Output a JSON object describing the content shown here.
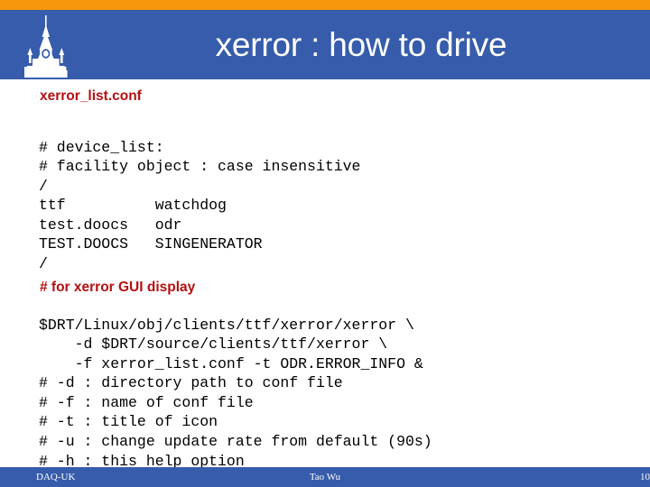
{
  "theme": {
    "accent_orange": "#F7970B",
    "brand_blue": "#365CAB",
    "heading_red": "#B50F10",
    "body_text": "#000000",
    "page_background": "#FFFFFF"
  },
  "header": {
    "title": "xerror : how to drive",
    "logo_name": "university-tower-logo"
  },
  "content": {
    "heading_conf": "xerror_list.conf",
    "code_block_1": "# device_list:\n# facility object : case insensitive\n/\nttf          watchdog\ntest.doocs   odr\nTEST.DOOCS   SINGENERATOR\n/",
    "heading_gui": "# for xerror GUI display",
    "code_block_2": "$DRT/Linux/obj/clients/ttf/xerror/xerror \\\n    -d $DRT/source/clients/ttf/xerror \\\n    -f xerror_list.conf -t ODR.ERROR_INFO &\n# -d : directory path to conf file\n# -f : name of conf file\n# -t : title of icon\n# -u : change update rate from default (90s)\n# -h : this help option"
  },
  "footer": {
    "left": "DAQ-UK",
    "center": "Tao Wu",
    "page_number": "10"
  }
}
